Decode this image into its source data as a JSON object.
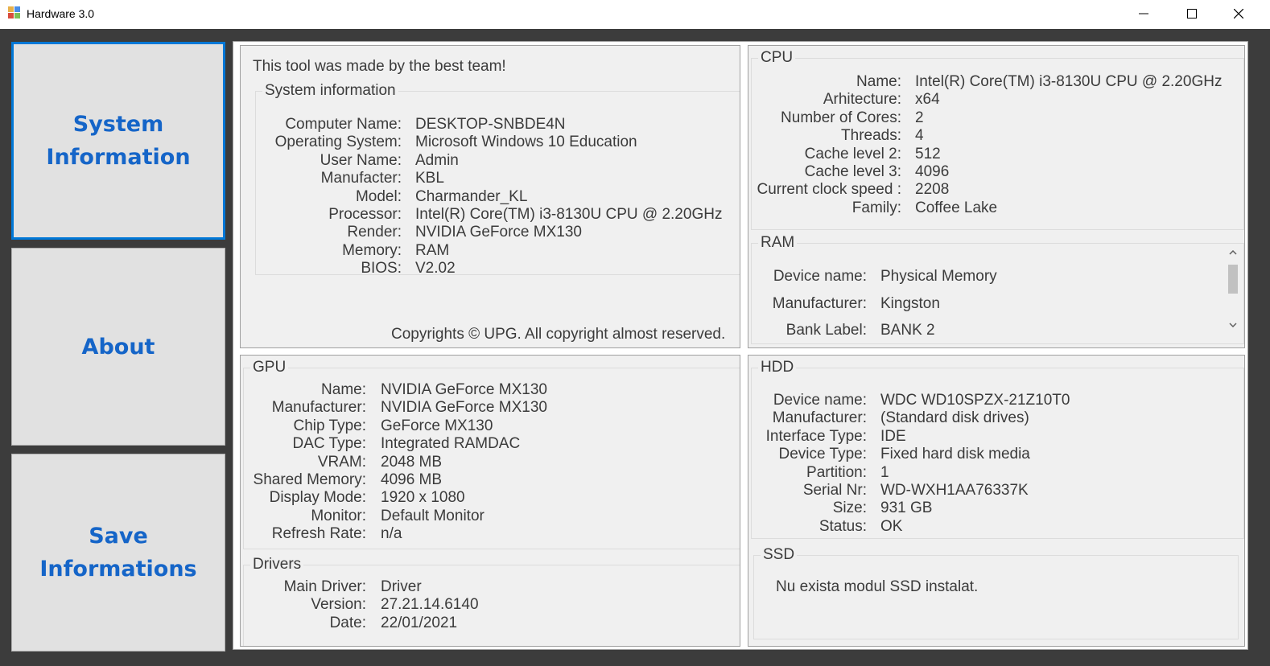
{
  "window": {
    "title": "Hardware 3.0"
  },
  "nav": {
    "system_line1": "System",
    "system_line2": "Information",
    "about": "About",
    "save_line1": "Save",
    "save_line2": "Informations"
  },
  "header_note": "This tool was made by the best team!",
  "copyright": "Copyrights © UPG.  All copyright almost reserved.",
  "system": {
    "title": "System information",
    "rows": [
      {
        "label": "Computer Name:",
        "value": "DESKTOP-SNBDE4N"
      },
      {
        "label": "Operating System:",
        "value": "Microsoft Windows 10 Education"
      },
      {
        "label": "User Name:",
        "value": "Admin"
      },
      {
        "label": "Manufacter:",
        "value": "KBL"
      },
      {
        "label": "Model:",
        "value": "Charmander_KL"
      },
      {
        "label": "Processor:",
        "value": "Intel(R) Core(TM) i3-8130U CPU @ 2.20GHz"
      },
      {
        "label": "Render:",
        "value": "NVIDIA GeForce MX130"
      },
      {
        "label": "Memory:",
        "value": "RAM"
      },
      {
        "label": "BIOS:",
        "value": "V2.02"
      }
    ]
  },
  "cpu": {
    "title": "CPU",
    "rows": [
      {
        "label": "Name:",
        "value": "Intel(R) Core(TM) i3-8130U CPU @ 2.20GHz"
      },
      {
        "label": "Arhitecture:",
        "value": "x64"
      },
      {
        "label": "Number of Cores:",
        "value": "2"
      },
      {
        "label": "Threads:",
        "value": "4"
      },
      {
        "label": "Cache level 2:",
        "value": "512"
      },
      {
        "label": "Cache level 3:",
        "value": "4096"
      },
      {
        "label": "Current clock speed :",
        "value": "2208"
      },
      {
        "label": "Family:",
        "value": "Coffee Lake"
      }
    ]
  },
  "ram": {
    "title": "RAM",
    "rows": [
      {
        "label": "Device name:",
        "value": "Physical Memory"
      },
      {
        "label": "Manufacturer:",
        "value": "Kingston"
      },
      {
        "label": "Bank Label:",
        "value": "BANK 2"
      }
    ]
  },
  "gpu": {
    "title": "GPU",
    "rows": [
      {
        "label": "Name:",
        "value": "NVIDIA GeForce MX130"
      },
      {
        "label": "Manufacturer:",
        "value": "NVIDIA GeForce MX130"
      },
      {
        "label": "Chip Type:",
        "value": "GeForce MX130"
      },
      {
        "label": "DAC Type:",
        "value": "Integrated RAMDAC"
      },
      {
        "label": "VRAM:",
        "value": "2048 MB"
      },
      {
        "label": "Shared Memory:",
        "value": "4096 MB"
      },
      {
        "label": "Display Mode:",
        "value": "1920 x 1080"
      },
      {
        "label": "Monitor:",
        "value": "Default Monitor"
      },
      {
        "label": "Refresh Rate:",
        "value": "n/a"
      }
    ]
  },
  "drivers": {
    "title": "Drivers",
    "rows": [
      {
        "label": "Main Driver:",
        "value": "Driver"
      },
      {
        "label": "Version:",
        "value": "27.21.14.6140"
      },
      {
        "label": "Date:",
        "value": "22/01/2021"
      }
    ]
  },
  "hdd": {
    "title": "HDD",
    "rows": [
      {
        "label": "Device name:",
        "value": "WDC WD10SPZX-21Z10T0"
      },
      {
        "label": "Manufacturer:",
        "value": "(Standard disk drives)"
      },
      {
        "label": "Interface Type:",
        "value": "IDE"
      },
      {
        "label": "Device Type:",
        "value": "Fixed hard disk media"
      },
      {
        "label": "Partition:",
        "value": "1"
      },
      {
        "label": "Serial Nr:",
        "value": "    WD-WXH1AA76337K"
      },
      {
        "label": "Size:",
        "value": "931 GB"
      },
      {
        "label": "Status:",
        "value": "OK"
      }
    ]
  },
  "ssd": {
    "title": "SSD",
    "message": "Nu exista modul SSD instalat."
  }
}
